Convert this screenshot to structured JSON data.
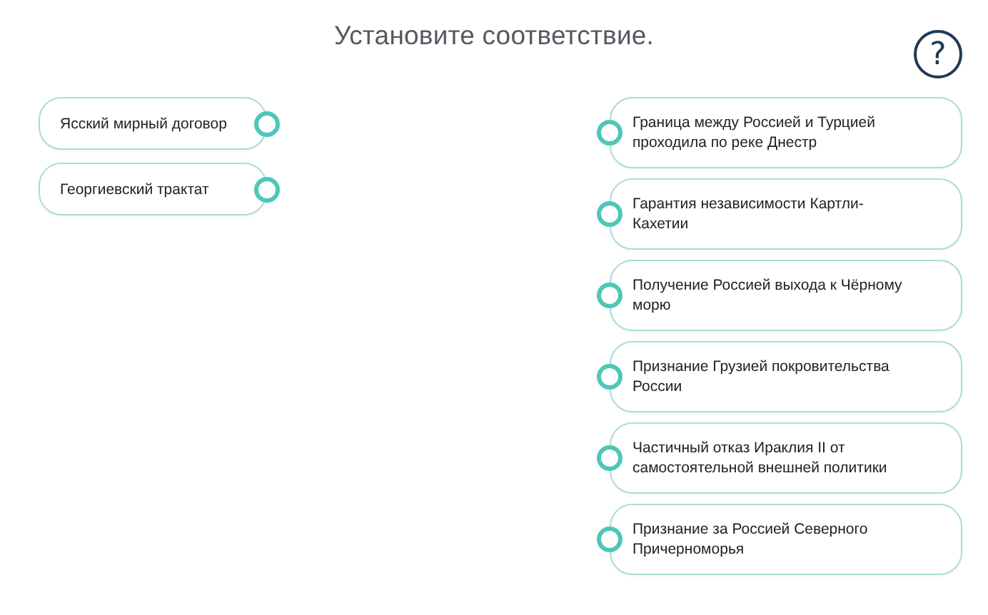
{
  "title": "Установите соответствие.",
  "help": {
    "label": "?"
  },
  "left_items": [
    {
      "text": "Ясский мирный договор"
    },
    {
      "text": "Георгиевский трактат"
    }
  ],
  "right_items": [
    {
      "text": "Граница между Россией и Турцией проходила по реке Днестр"
    },
    {
      "text": "Гарантия независимости Картли-Кахетии"
    },
    {
      "text": "Получение Россией выхода к Чёрному морю"
    },
    {
      "text": "Признание Грузией покровительства России"
    },
    {
      "text": "Частичный отказ Ираклия II от самостоятельной внешней политики"
    },
    {
      "text": "Признание за Россией Северного Причерноморья"
    }
  ]
}
